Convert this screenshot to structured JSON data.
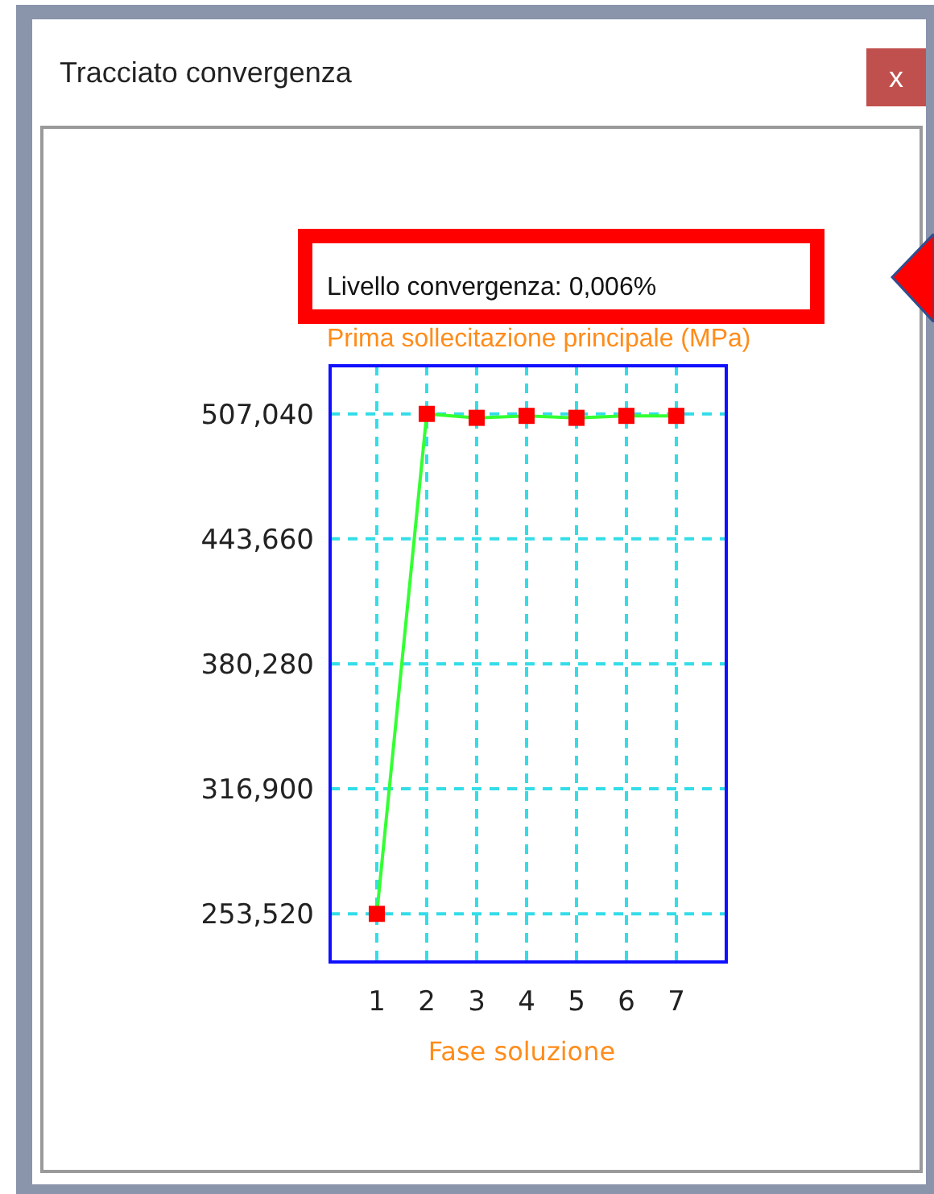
{
  "window": {
    "title": "Tracciato convergenza",
    "close": "x"
  },
  "annotation": {
    "text": "Livello convergenza: 0,006%"
  },
  "chart": {
    "chart_data": {
      "type": "line",
      "title": "Prima sollecitazione principale (MPa)",
      "xlabel": "Fase soluzione",
      "grid": true,
      "x": [
        1,
        2,
        3,
        4,
        5,
        6,
        7
      ],
      "series": [
        {
          "color": "#33ff33",
          "marker": "square",
          "values": [
            253500,
            507000,
            505000,
            506000,
            505000,
            506000,
            506000
          ]
        }
      ],
      "xlim": [
        0.065,
        8
      ],
      "ylim": [
        229100,
        531400
      ],
      "xticks": [
        1,
        2,
        3,
        4,
        5,
        6,
        7
      ],
      "yticks": [
        {
          "value": 253520,
          "label": "253,520"
        },
        {
          "value": 316900,
          "label": "316,900"
        },
        {
          "value": 380280,
          "label": "380,280"
        },
        {
          "value": 443660,
          "label": "443,660"
        },
        {
          "value": 507040,
          "label": "507,040"
        }
      ]
    }
  }
}
